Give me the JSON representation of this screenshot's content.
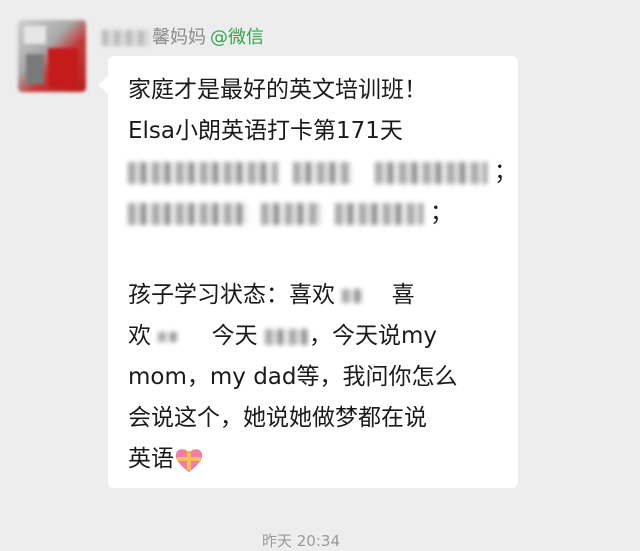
{
  "sender": {
    "name_suffix": "馨妈妈",
    "mention": "@微信"
  },
  "message": {
    "line1": "家庭才是最好的英文培训班！",
    "line2": "Elsa小朗英语打卡第171天",
    "line3_end": "；",
    "line4_end": "；",
    "line6a": "孩子学习状态：喜欢",
    "line6b": "喜",
    "line7a": "欢",
    "line7b": "今天",
    "line7c": "，今天说my",
    "line8": "mom，my dad等，我问你怎么",
    "line9": "会说这个，她说她做梦都在说",
    "line10": "英语",
    "emoji_icon": "heart-with-ribbon-icon"
  },
  "timestamp": "昨天 20:34"
}
